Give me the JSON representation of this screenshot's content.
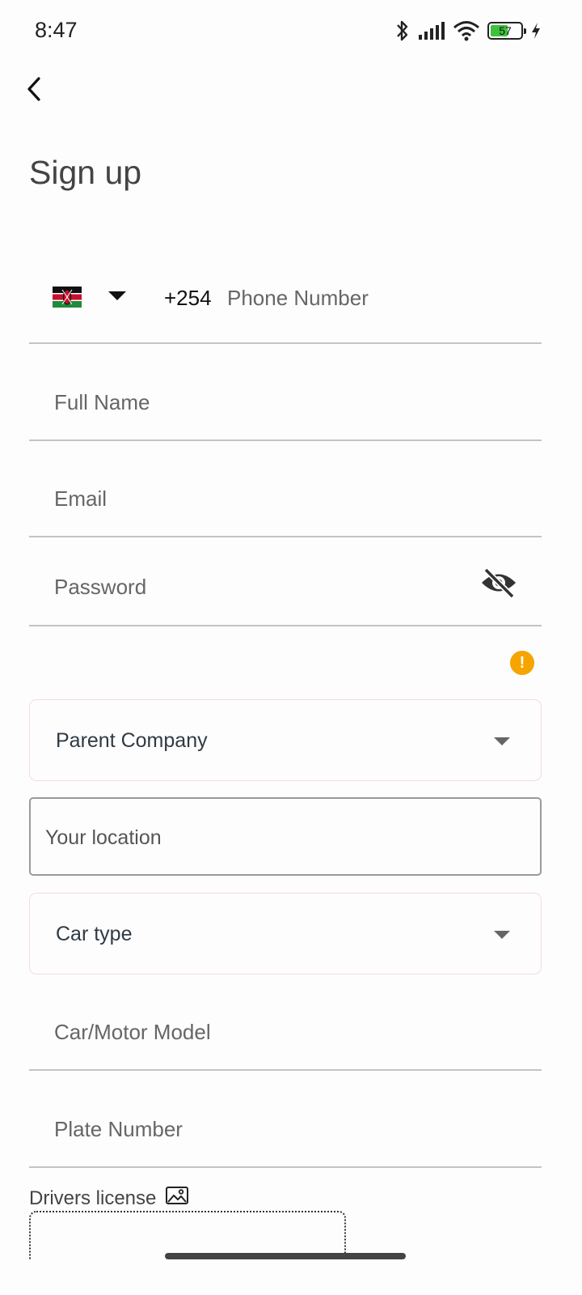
{
  "status_bar": {
    "time": "8:47",
    "battery_level": "57",
    "battery_fraction": 0.57,
    "icons": [
      "bluetooth-icon",
      "signal-icon",
      "wifi-icon",
      "battery-icon",
      "charging-icon"
    ]
  },
  "header": {
    "back_icon": "chevron-left-icon",
    "title": "Sign up"
  },
  "form": {
    "phone": {
      "country_flag": "kenya-flag-icon",
      "dial_code": "+254",
      "placeholder": "Phone Number",
      "value": ""
    },
    "full_name": {
      "label": "Full Name",
      "value": ""
    },
    "email": {
      "label": "Email",
      "value": ""
    },
    "password": {
      "label": "Password",
      "value": "",
      "toggle_icon": "eye-off-icon"
    },
    "warning_icon": "!",
    "parent_company": {
      "label": "Parent Company"
    },
    "location": {
      "placeholder": "Your location",
      "value": ""
    },
    "car_type": {
      "label": "Car type"
    },
    "car_model": {
      "label": "Car/Motor Model",
      "value": ""
    },
    "plate_number": {
      "label": "Plate Number",
      "value": ""
    },
    "drivers_license": {
      "label": "Drivers license",
      "icon": "image-icon"
    }
  },
  "colors": {
    "warning": "#f5a400",
    "battery": "#3cc23c",
    "underline": "#c4c4c4",
    "dropdown_border": "#f3dcdc"
  }
}
